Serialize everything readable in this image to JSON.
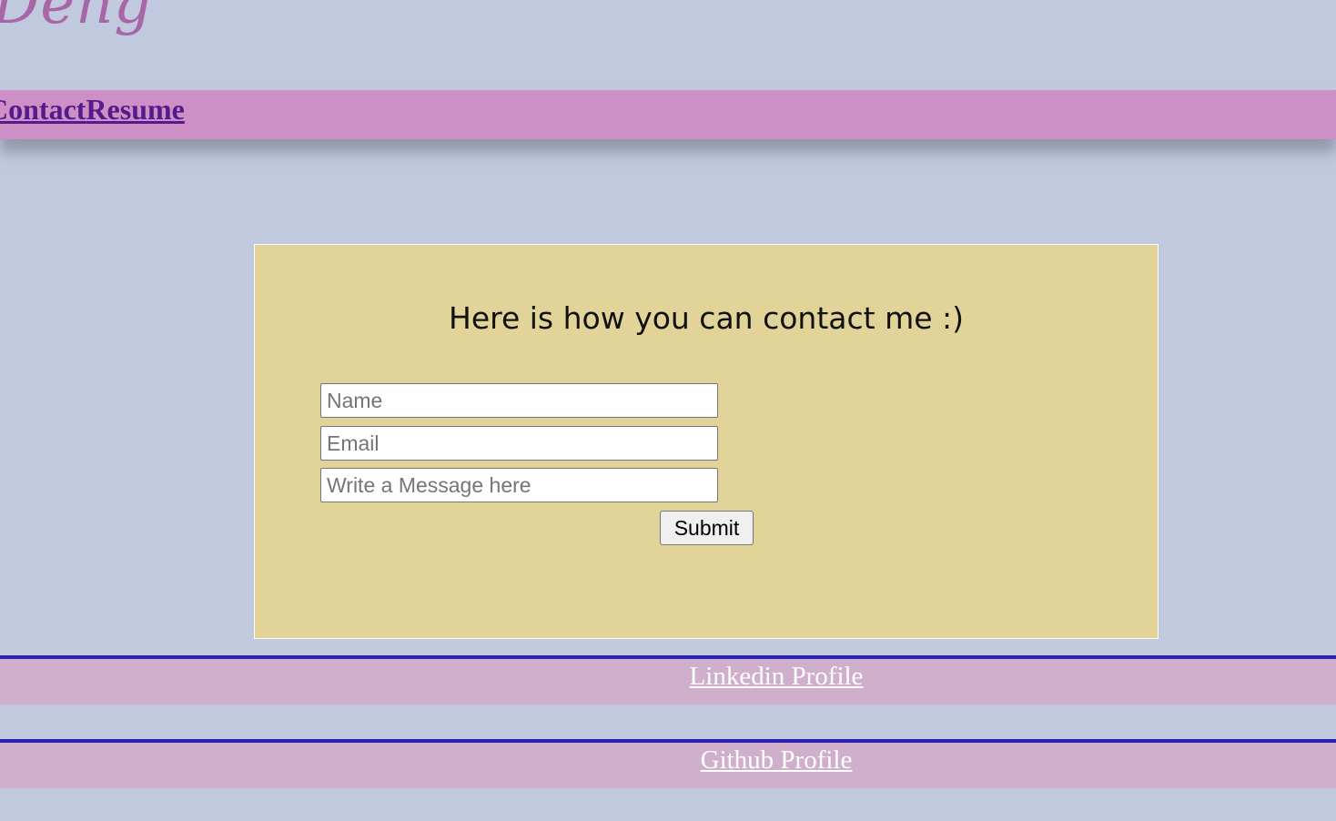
{
  "header": {
    "site_title": "Deng"
  },
  "nav": {
    "items": [
      {
        "label": "Contact"
      },
      {
        "label": "Resume"
      }
    ]
  },
  "contact": {
    "heading": "Here is how you can contact me :)",
    "fields": {
      "name_placeholder": "Name",
      "email_placeholder": "Email",
      "message_placeholder": "Write a Message here"
    },
    "submit_label": "Submit"
  },
  "footer": {
    "links": [
      {
        "label": "Linkedin Profile"
      },
      {
        "label": "Github Profile"
      }
    ]
  },
  "colors": {
    "page_background": "#c1c9de",
    "navbar": "#ce8fc6",
    "card": "#e2d498",
    "footer_bar": "#d0afcd",
    "footer_border": "#2a23b1",
    "title": "#a866a6",
    "nav_link": "#551a8b"
  }
}
